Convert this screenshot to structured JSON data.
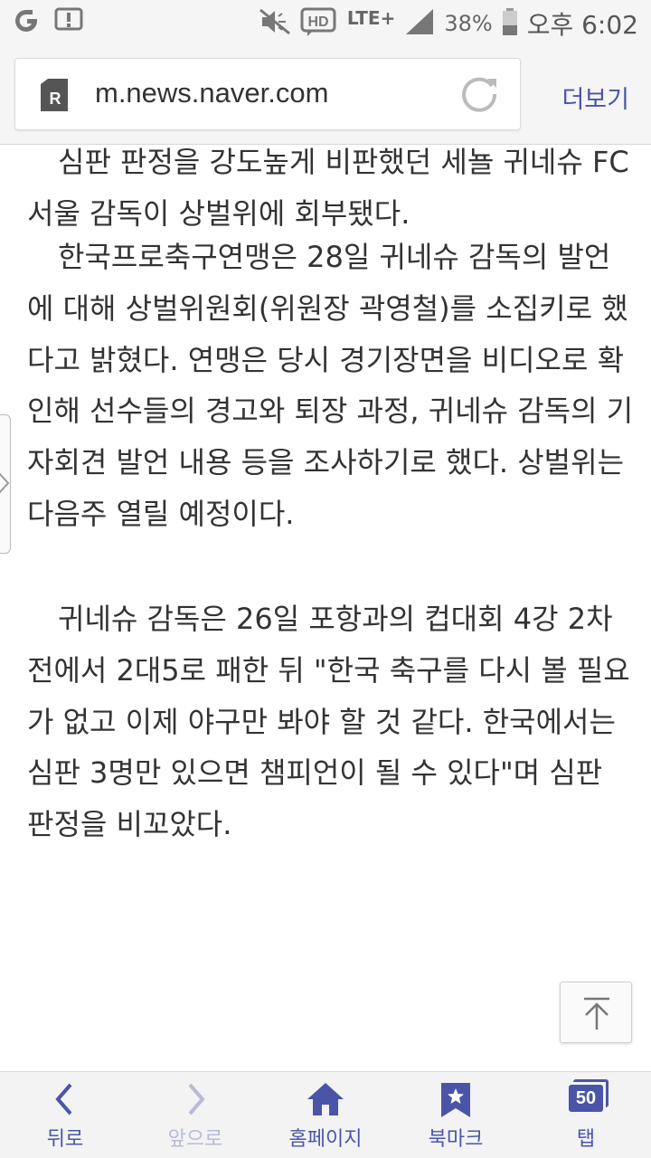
{
  "status_bar": {
    "battery": "38%",
    "time": "오후 6:02",
    "network": "LTE+"
  },
  "browser": {
    "url": "m.news.naver.com",
    "more_label": "더보기"
  },
  "article": {
    "paragraphs": [
      "심판 판정을 강도높게 비판했던 세뇰 귀네슈 FC서울 감독이 상벌위에 회부됐다.",
      "한국프로축구연맹은 28일 귀네슈 감독의 발언에 대해 상벌위원회(위원장 곽영철)를 소집키로 했다고 밝혔다. 연맹은 당시 경기장면을 비디오로 확인해 선수들의 경고와 퇴장 과정, 귀네슈 감독의 기자회견 발언 내용 등을 조사하기로 했다. 상벌위는 다음주 열릴 예정이다.",
      "귀네슈 감독은 26일 포항과의 컵대회 4강 2차전에서 2대5로 패한 뒤 \"한국 축구를 다시 볼 필요가 없고 이제 야구만 봐야 할 것 같다. 한국에서는 심판 3명만 있으면 챔피언이 될 수 있다\"며 심판 판정을 비꼬았다."
    ]
  },
  "bottom_nav": {
    "back": "뒤로",
    "forward": "앞으로",
    "home": "홈페이지",
    "bookmark": "북마크",
    "tabs": "탭",
    "tab_count": "50"
  },
  "colors": {
    "accent": "#4a55a8",
    "disabled": "#b8bbd5"
  }
}
